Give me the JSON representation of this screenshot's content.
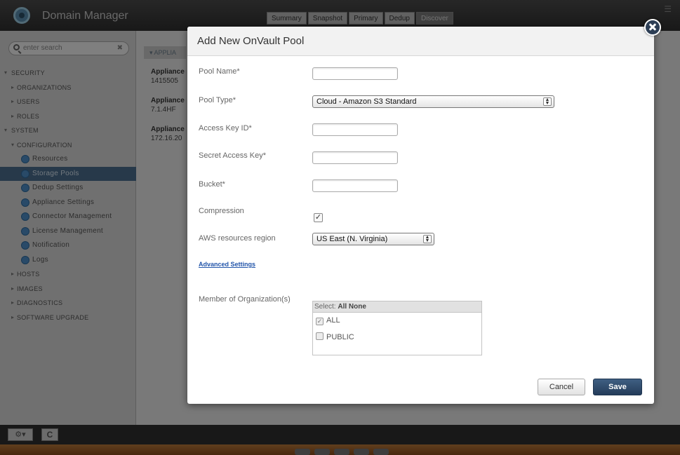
{
  "app": {
    "title": "Domain Manager",
    "tabs": [
      "Summary",
      "Snapshot",
      "Primary",
      "Dedup",
      "Discover"
    ],
    "search": {
      "placeholder": "enter search"
    },
    "nav": [
      {
        "label": "SECURITY",
        "level": 0,
        "arrow": "▾"
      },
      {
        "label": "ORGANIZATIONS",
        "level": 1,
        "arrow": "▸"
      },
      {
        "label": "USERS",
        "level": 1,
        "arrow": "▸"
      },
      {
        "label": "ROLES",
        "level": 1,
        "arrow": "▸"
      },
      {
        "label": "SYSTEM",
        "level": 0,
        "arrow": "▾"
      },
      {
        "label": "CONFIGURATION",
        "level": 1,
        "arrow": "▾"
      },
      {
        "label": "Resources",
        "level": 2
      },
      {
        "label": "Storage Pools",
        "level": 2,
        "selected": true
      },
      {
        "label": "Dedup Settings",
        "level": 2
      },
      {
        "label": "Appliance Settings",
        "level": 2
      },
      {
        "label": "Connector Management",
        "level": 2
      },
      {
        "label": "License Management",
        "level": 2
      },
      {
        "label": "Notification",
        "level": 2
      },
      {
        "label": "Logs",
        "level": 2
      },
      {
        "label": "HOSTS",
        "level": 1,
        "arrow": "▸"
      },
      {
        "label": "IMAGES",
        "level": 1,
        "arrow": "▸"
      },
      {
        "label": "DIAGNOSTICS",
        "level": 1,
        "arrow": "▸"
      },
      {
        "label": "SOFTWARE UPGRADE",
        "level": 1,
        "arrow": "▸"
      }
    ],
    "content_header": "▾ APPLIA",
    "appliance_rows": [
      {
        "title": "Appliance",
        "value": "1415505"
      },
      {
        "title": "Appliance",
        "value": "7.1.4HF"
      },
      {
        "title": "Appliance",
        "value": "172.16.20"
      }
    ],
    "bottom": {
      "gear_label": "⚙▾",
      "refresh_label": "C"
    },
    "colors": {
      "selected_nav": "#4b6e8e",
      "save_button": "#2b4565",
      "accent_link": "#2255aa"
    }
  },
  "modal": {
    "title": "Add New OnVault Pool",
    "fields": {
      "pool_name": {
        "label": "Pool Name*",
        "value": ""
      },
      "pool_type": {
        "label": "Pool Type*",
        "value": "Cloud - Amazon S3 Standard"
      },
      "access_key": {
        "label": "Access Key ID*",
        "value": ""
      },
      "secret_key": {
        "label": "Secret Access Key*",
        "value": ""
      },
      "bucket": {
        "label": "Bucket*",
        "value": ""
      },
      "compression": {
        "label": "Compression",
        "checked": true,
        "mark": "✓"
      },
      "region": {
        "label": "AWS resources region",
        "value": "US East (N. Virginia)"
      }
    },
    "advanced_link": "Advanced Settings",
    "org": {
      "label": "Member of Organization(s)",
      "select_prefix": "Select:",
      "select_all": "All",
      "select_none": "None",
      "options": [
        {
          "label": "ALL",
          "checked": true,
          "mark": "✓"
        },
        {
          "label": "PUBLIC",
          "checked": false,
          "mark": ""
        }
      ]
    },
    "buttons": {
      "cancel": "Cancel",
      "save": "Save"
    }
  }
}
